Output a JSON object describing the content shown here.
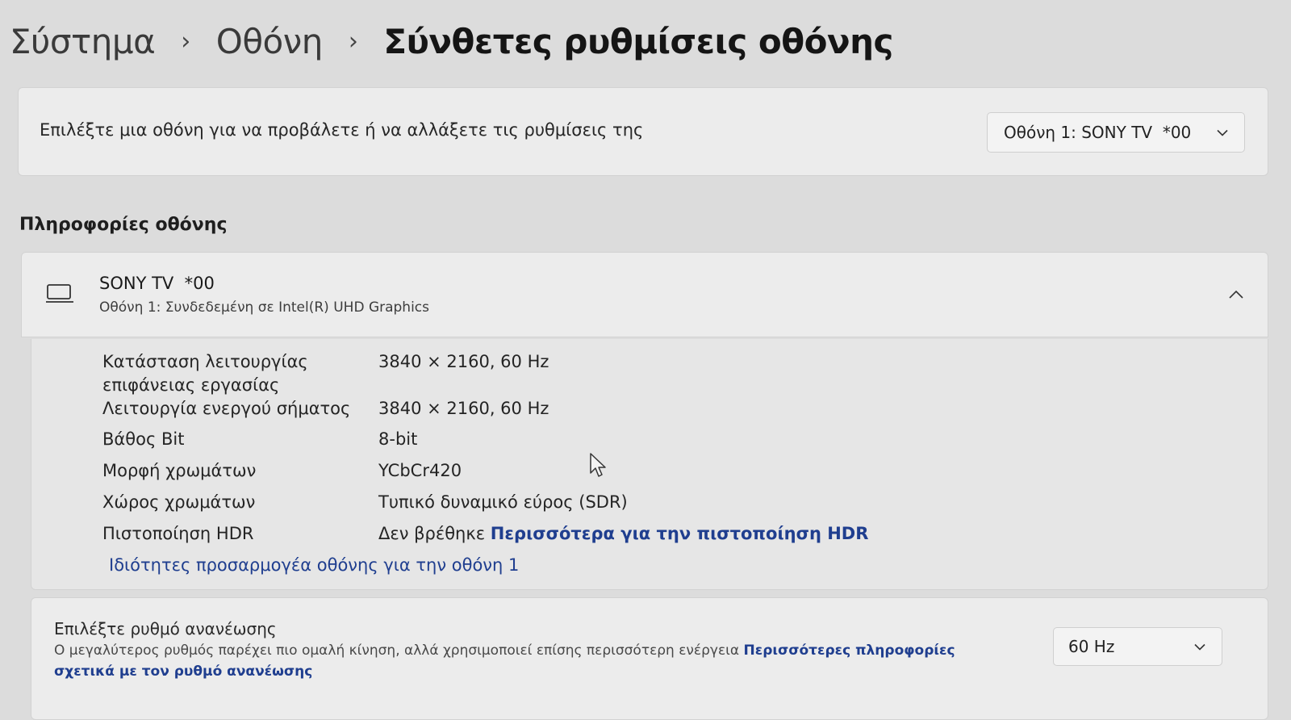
{
  "breadcrumb": {
    "items": [
      "Σύστημα",
      "Οθόνη",
      "Σύνθετες ρυθμίσεις οθόνης"
    ],
    "separator": "›"
  },
  "display_select": {
    "label": "Επιλέξτε μια οθόνη για να προβάλετε ή να αλλάξετε τις ρυθμίσεις της",
    "selected": "Οθόνη 1: SONY TV  *00"
  },
  "display_info": {
    "section_title": "Πληροφορίες οθόνης",
    "monitor_name": "SONY TV  *00",
    "monitor_subtitle": "Οθόνη 1: Συνδεδεμένη σε Intel(R) UHD Graphics",
    "rows": [
      {
        "key": "Κατάσταση λειτουργίας επιφάνειας εργασίας",
        "value": "3840 × 2160, 60 Hz"
      },
      {
        "key": "Λειτουργία ενεργού σήματος",
        "value": "3840 × 2160, 60 Hz"
      },
      {
        "key": "Βάθος Bit",
        "value": "8-bit"
      },
      {
        "key": "Μορφή χρωμάτων",
        "value": "YCbCr420"
      },
      {
        "key": "Χώρος χρωμάτων",
        "value": "Τυπικό δυναμικό εύρος (SDR)"
      },
      {
        "key": "Πιστοποίηση HDR",
        "value": "Δεν βρέθηκε",
        "link": "Περισσότερα για την πιστοποίηση HDR"
      }
    ],
    "adapter_link": "Ιδιότητες προσαρμογέα οθόνης για την οθόνη 1"
  },
  "refresh_rate": {
    "title": "Επιλέξτε ρυθμό ανανέωσης",
    "description": "Ο μεγαλύτερος ρυθμός παρέχει πιο ομαλή κίνηση, αλλά χρησιμοποιεί επίσης περισσότερη ενέργεια",
    "link": "Περισσότερες πληροφορίες σχετικά με τον ρυθμό ανανέωσης",
    "selected": "60 Hz"
  },
  "icons": {
    "monitor": "monitor-icon",
    "chevron_down": "chevron-down-icon",
    "chevron_up": "chevron-up-icon",
    "cursor": "mouse-cursor-icon"
  },
  "colors": {
    "link": "#1f3e8f",
    "background": "#dcdcdc",
    "card": "#ececec"
  }
}
